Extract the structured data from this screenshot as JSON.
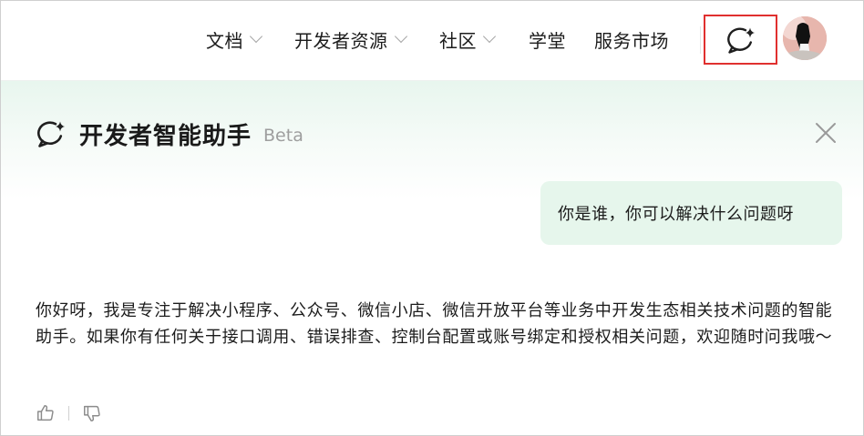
{
  "nav": {
    "items": [
      {
        "label": "文档",
        "has_dropdown": true
      },
      {
        "label": "开发者资源",
        "has_dropdown": true
      },
      {
        "label": "社区",
        "has_dropdown": true
      },
      {
        "label": "学堂",
        "has_dropdown": false
      },
      {
        "label": "服务市场",
        "has_dropdown": false
      }
    ],
    "assistant_icon": "chat-sparkle-icon",
    "highlight_color": "#e0302f"
  },
  "panel": {
    "title": "开发者智能助手",
    "badge": "Beta",
    "header_icon": "chat-sparkle-icon",
    "close_icon": "close-icon",
    "background_accent": "#e6f6ec"
  },
  "conversation": {
    "user_message": "你是谁，你可以解决什么问题呀",
    "assistant_reply": "你好呀，我是专注于解决小程序、公众号、微信小店、微信开放平台等业务中开发生态相关技术问题的智能助手。如果你有任何关于接口调用、错误排查、控制台配置或账号绑定和授权相关问题，欢迎随时问我哦～"
  },
  "feedback": {
    "like_icon": "thumbs-up-icon",
    "dislike_icon": "thumbs-down-icon"
  }
}
